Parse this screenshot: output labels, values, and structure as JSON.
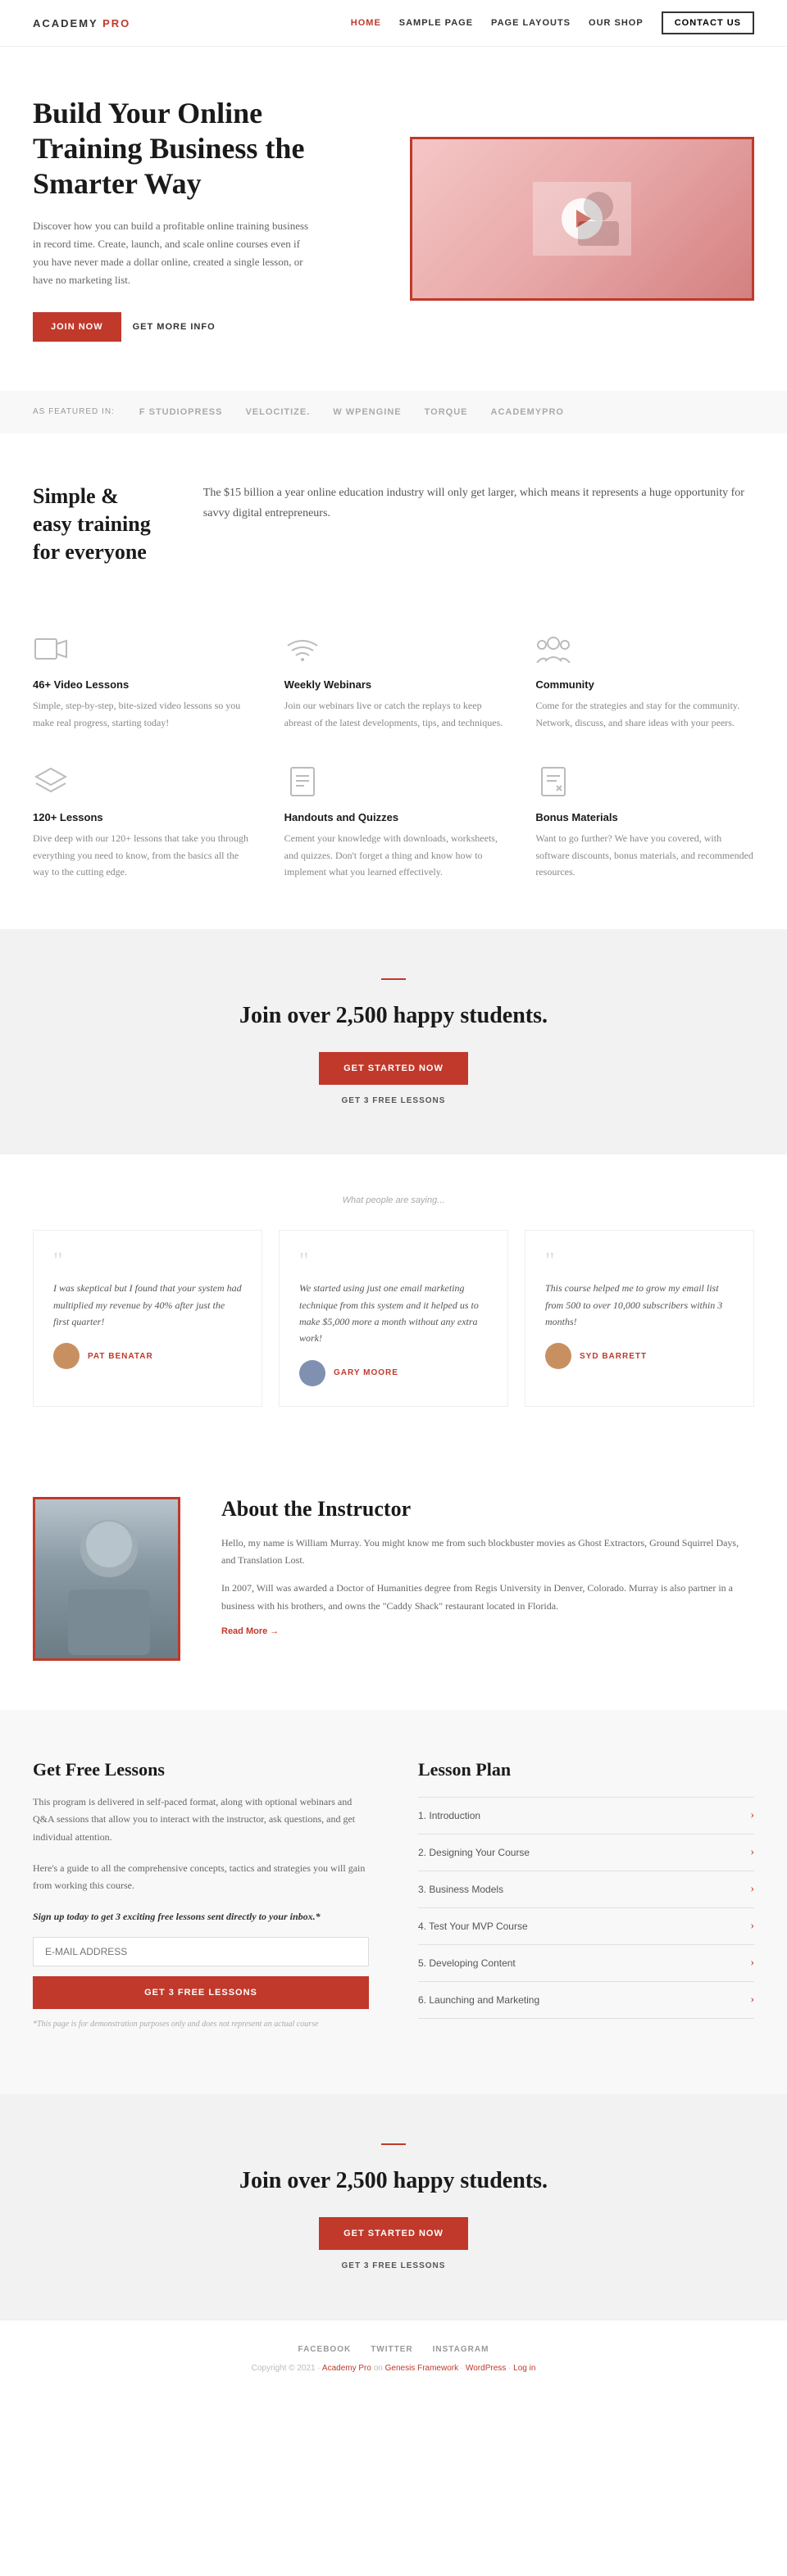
{
  "navbar": {
    "logo": "ACADEMY PRO",
    "logo_accent": "PRO",
    "links": [
      {
        "label": "HOME",
        "active": true
      },
      {
        "label": "SAMPLE PAGE",
        "active": false
      },
      {
        "label": "PAGE LAYOUTS",
        "active": false
      },
      {
        "label": "OUR SHOP",
        "active": false
      }
    ],
    "cta_button": "CONTACT US"
  },
  "hero": {
    "headline": "Build Your Online Training Business the Smarter Way",
    "description": "Discover how you can build a profitable online training business in record time. Create, launch, and scale online courses even if you have never made a dollar online, created a single lesson, or have no marketing list.",
    "cta_primary": "JOIN NOW",
    "cta_secondary": "GET MORE INFO",
    "join_button": "JOIN NOW"
  },
  "featured": {
    "label": "As Featured In:",
    "logos": [
      "F STUDIOPRESS",
      "VELOCITIZE.",
      "W WPengine",
      "TORQUE",
      "academypro"
    ]
  },
  "intro": {
    "heading": "Simple & easy training for everyone",
    "body": "The $15 billion a year online education industry will only get larger, which means it represents a huge opportunity for savvy digital entrepreneurs."
  },
  "features": [
    {
      "icon": "video",
      "title": "46+ Video Lessons",
      "description": "Simple, step-by-step, bite-sized video lessons so you make real progress, starting today!"
    },
    {
      "icon": "wifi",
      "title": "Weekly Webinars",
      "description": "Join our webinars live or catch the replays to keep abreast of the latest developments, tips, and techniques."
    },
    {
      "icon": "community",
      "title": "Community",
      "description": "Come for the strategies and stay for the community. Network, discuss, and share ideas with your peers."
    },
    {
      "icon": "layers",
      "title": "120+ Lessons",
      "description": "Dive deep with our 120+ lessons that take you through everything you need to know, from the basics all the way to the cutting edge."
    },
    {
      "icon": "document",
      "title": "Handouts and Quizzes",
      "description": "Cement your knowledge with downloads, worksheets, and quizzes. Don't forget a thing and know how to implement what you learned effectively."
    },
    {
      "icon": "bonus",
      "title": "Bonus Materials",
      "description": "Want to go further? We have you covered, with software discounts, bonus materials, and recommended resources."
    }
  ],
  "cta": {
    "heading": "Join over 2,500 happy students.",
    "button": "GET STARTED NOW",
    "link": "GET 3 FREE LESSONS"
  },
  "testimonials": {
    "label": "What people are saying...",
    "items": [
      {
        "text": "I was skeptical but I found that your system had multiplied my revenue by 40% after just the first quarter!",
        "author": "PAT BENATAR",
        "avatar_color": "#c89060"
      },
      {
        "text": "We started using just one email marketing technique from this system and it helped us to make $5,000 more a month without any extra work!",
        "author": "GARY MOORE",
        "avatar_color": "#8090b0"
      },
      {
        "text": "This course helped me to grow my email list from 500 to over 10,000 subscribers within 3 months!",
        "author": "SYD BARRETT",
        "avatar_color": "#c89060"
      }
    ]
  },
  "instructor": {
    "heading": "About the Instructor",
    "body1": "Hello, my name is William Murray. You might know me from such blockbuster movies as Ghost Extractors, Ground Squirrel Days, and Translation Lost.",
    "body2": "In 2007, Will was awarded a Doctor of Humanities degree from Regis University in Denver, Colorado. Murray is also partner in a business with his brothers, and owns the \"Caddy Shack\" restaurant located in Florida.",
    "read_more": "Read More →"
  },
  "free_lessons": {
    "heading": "Get Free Lessons",
    "body1": "This program is delivered in self-paced format, along with optional webinars and Q&A sessions that allow you to interact with the instructor, ask questions, and get individual attention.",
    "body2": "Here's a guide to all the comprehensive concepts, tactics and strategies you will gain from working this course.",
    "signup_note": "Sign up today to get 3 exciting free lessons sent directly to your inbox.*",
    "email_placeholder": "E-MAIL ADDRESS",
    "button": "GET 3 FREE LESSONS",
    "disclaimer": "*This page is for demonstration purposes only and does not represent an actual course"
  },
  "lesson_plan": {
    "heading": "Lesson Plan",
    "lessons": [
      {
        "number": "1.",
        "title": "Introduction"
      },
      {
        "number": "2.",
        "title": "Designing Your Course"
      },
      {
        "number": "3.",
        "title": "Business Models"
      },
      {
        "number": "4.",
        "title": "Test Your MVP Course"
      },
      {
        "number": "5.",
        "title": "Developing Content"
      },
      {
        "number": "6.",
        "title": "Launching and Marketing"
      }
    ]
  },
  "cta2": {
    "heading": "Join over 2,500 happy students.",
    "button": "GET STARTED NOW",
    "link": "GET 3 FREE LESSONS"
  },
  "footer": {
    "links": [
      "FACEBOOK",
      "TWITTER",
      "INSTAGRAM"
    ],
    "copy": "Copyright © 2021 · Academy Pro on Genesis Framework · WordPress · Log in"
  }
}
